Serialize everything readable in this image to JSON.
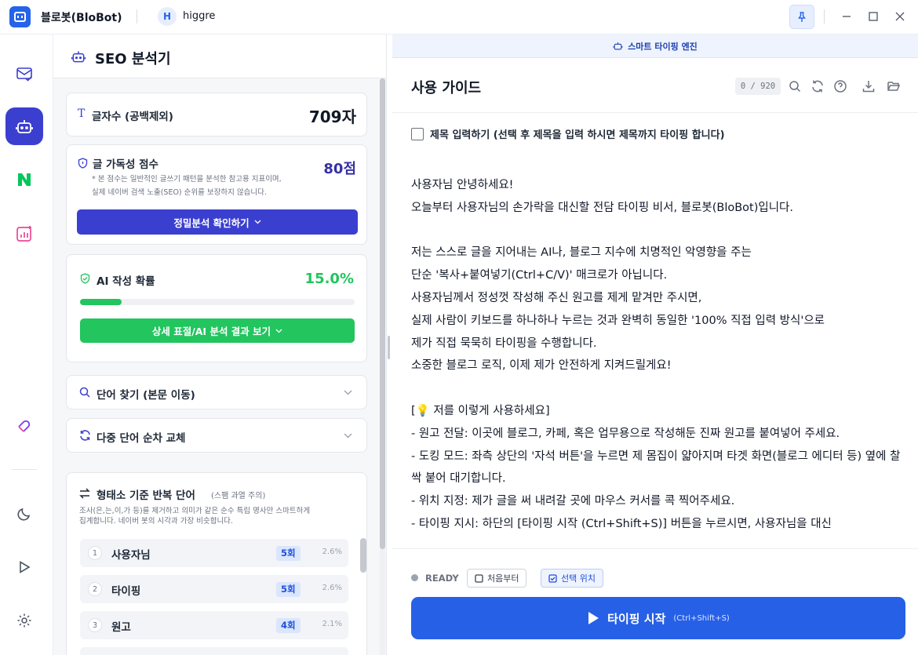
{
  "titlebar": {
    "app_title": "블로봇(BloBot)",
    "avatar_initial": "H",
    "username": "higgre"
  },
  "sidebar": {
    "items": [
      {
        "icon": "mail-check-icon",
        "active": false
      },
      {
        "icon": "robot-icon",
        "active": true
      },
      {
        "icon": "naver-n-icon",
        "active": false
      },
      {
        "icon": "chart-sparkle-icon",
        "active": false
      },
      {
        "icon": "magnet-icon",
        "active": false
      },
      {
        "icon": "moon-icon",
        "active": false
      },
      {
        "icon": "play-icon",
        "active": false
      },
      {
        "icon": "gear-icon",
        "active": false
      }
    ],
    "colors": {
      "active_bg": "#3b3fd0",
      "naver_green": "#03c75a",
      "pink": "#ec4899",
      "purple": "#7c3aed"
    }
  },
  "seo": {
    "title": "SEO 분석기",
    "char_count": {
      "label": "글자수 (공백제외)",
      "value": "709자"
    },
    "readability": {
      "label": "글 가독성 점수",
      "score": "80점",
      "note1": "* 본 점수는 일반적인 글쓰기 패턴을 분석한 참고용 지표이며,",
      "note2": "실제 네이버 검색 노출(SEO) 순위를 보장하지 않습니다.",
      "button": "정밀분석 확인하기"
    },
    "ai": {
      "label": "AI 작성 확률",
      "value": "15.0%",
      "progress": 0.15,
      "button": "상세 표절/AI 분석 결과 보기"
    },
    "find_word": "단어 찾기 (본문 이동)",
    "multi_replace": "다중 단어 순차 교체",
    "repeated": {
      "title": "형태소 기준 반복 단어",
      "title_sub": "(스팸 과열 주의)",
      "note1": "조사(은,는,이,가 등)를 제거하고 의미가 같은 순수 특립 명사만 스마트하게",
      "note2": "집계합니다. 네이버 봇의 시각과 가장 비슷합니다.",
      "rows": [
        {
          "num": "1",
          "word": "사용자님",
          "count": "5회",
          "pct": "2.6%"
        },
        {
          "num": "2",
          "word": "타이핑",
          "count": "5회",
          "pct": "2.6%"
        },
        {
          "num": "3",
          "word": "원고",
          "count": "4회",
          "pct": "2.1%"
        }
      ]
    },
    "colors": {
      "primary": "#3b3fd0",
      "green": "#22c55e",
      "score": "#3730a3"
    }
  },
  "editor": {
    "banner": "스마트 타이핑 엔진",
    "title": "사용 가이드",
    "counter": "0 / 920",
    "title_checkbox": "제목 입력하기 (선택 후 제목을 입력 하시면 제목까지 타이핑 합니다)",
    "lines": [
      "사용자님 안녕하세요!",
      "오늘부터 사용자님의 손가락을 대신할 전담 타이핑 비서, 블로봇(BloBot)입니다.",
      "",
      "저는 스스로 글을 지어내는 AI나, 블로그 지수에 치명적인 악영향을 주는",
      "단순 '복사+붙여넣기(Ctrl+C/V)' 매크로가 아닙니다.",
      "사용자님께서 정성껏 작성해 주신 원고를 제게 맡겨만 주시면,",
      "실제 사람이 키보드를 하나하나 누르는 것과 완벽히 동일한 '100% 직접 입력 방식'으로",
      "제가 직접 묵묵히 타이핑을 수행합니다.",
      "소중한 블로그 로직, 이제 제가 안전하게 지켜드릴게요!",
      "",
      "[💡 저를 이렇게 사용하세요]",
      "- 원고 전달: 이곳에 블로그, 카페, 혹은 업무용으로 작성해둔 진짜 원고를 붙여넣어 주세요.",
      "- 도킹 모드: 좌측 상단의 '자석 버튼'을 누르면 제 몸집이 얇아지며 타겟 화면(블로그 에디터 등) 옆에 찰싹 붙어 대기합니다.",
      "- 위치 지정: 제가 글을 써 내려갈 곳에 마우스 커서를 콕 찍어주세요.",
      "- 타이핑 지시: 하단의 [타이핑 시작 (Ctrl+Shift+S)] 버튼을 누르시면, 사용자님을 대신"
    ],
    "status": "READY",
    "chip_from_start": "처음부터",
    "chip_selected_pos": "선택 위치",
    "start_button": "타이핑 시작",
    "start_shortcut": "(Ctrl+Shift+S)",
    "colors": {
      "primary": "#2660e6",
      "banner_bg": "#eef3fd"
    }
  }
}
